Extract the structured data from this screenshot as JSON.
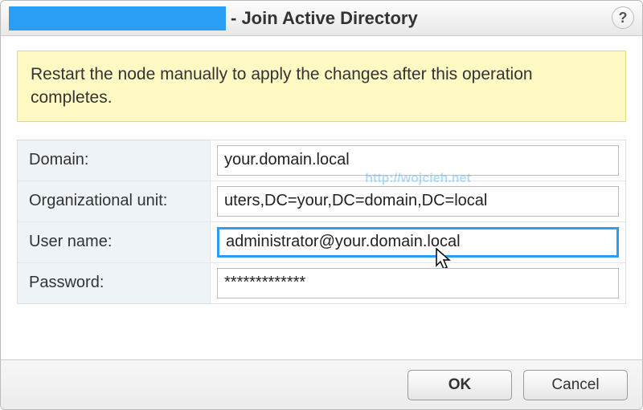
{
  "titlebar": {
    "title_suffix": "- Join Active Directory",
    "help_glyph": "?"
  },
  "notice": "Restart the node manually to apply the changes after this operation completes.",
  "form": {
    "domain": {
      "label": "Domain:",
      "value": "your.domain.local"
    },
    "ou": {
      "label": "Organizational unit:",
      "value": "uters,DC=your,DC=domain,DC=local"
    },
    "user": {
      "label": "User name:",
      "value": "administrator@your.domain.local"
    },
    "pass": {
      "label": "Password:",
      "value": "*************"
    }
  },
  "watermark": "http://wojcieh.net",
  "buttons": {
    "ok": "OK",
    "cancel": "Cancel"
  }
}
